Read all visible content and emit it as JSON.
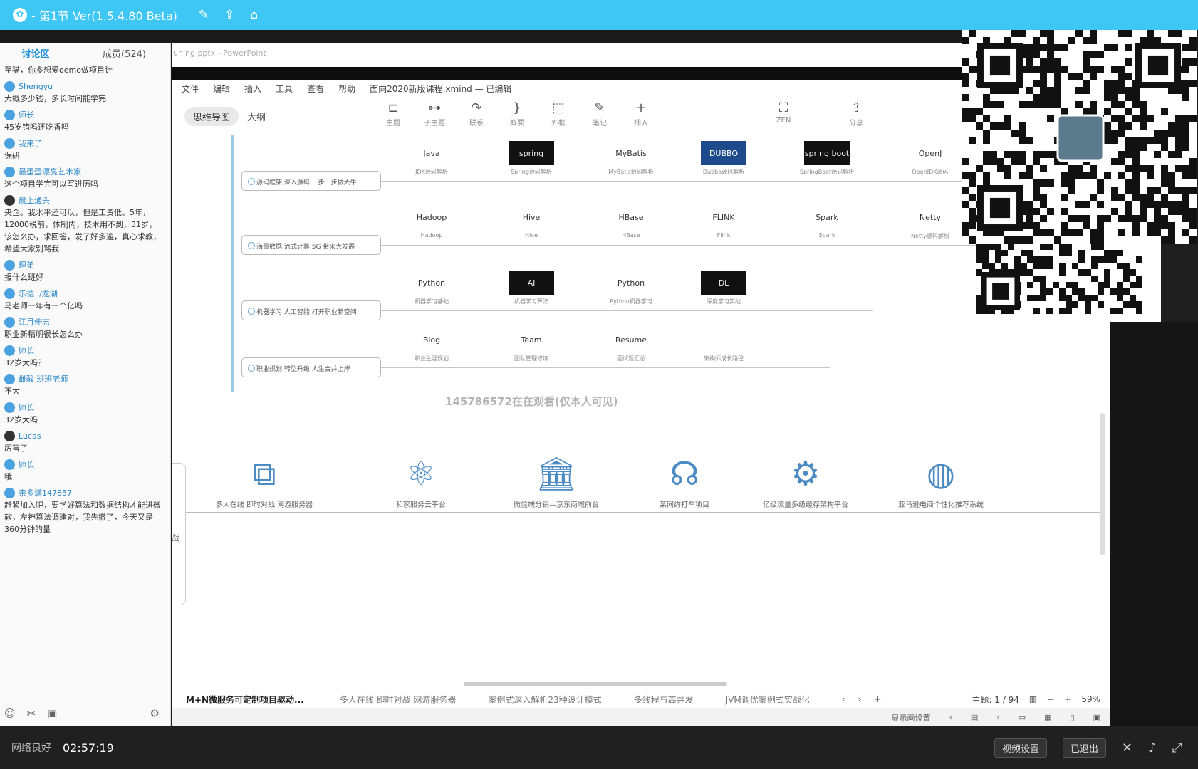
{
  "app": {
    "title": "- 第1节 Ver(1.5.4.80 Beta)",
    "icons": [
      "edit-icon",
      "share-out-icon",
      "home-icon"
    ]
  },
  "chat": {
    "tab": "讨论区",
    "members": "成员(524)",
    "messages": [
      {
        "user": "",
        "text": "至猫，你多想爱oemo做项目计"
      },
      {
        "user": "Shengyu",
        "text": "大概多少钱，多长时间能学完"
      },
      {
        "user": "师长",
        "text": "45岁错吗还吃香吗"
      },
      {
        "user": "我来了",
        "text": "保研"
      },
      {
        "user": "最蛋蛋漂亮艺术家",
        "text": "这个项目学完可以写进历吗"
      },
      {
        "user": "晨上通头",
        "text": "央企。我水平还可以，但是工资低。5年，12000税前，体制内，技术用不到，31岁，该怎么办，求回答，发了好多遍，真心求教，希望大家别骂我"
      },
      {
        "user": "理弟",
        "text": "报什么班好"
      },
      {
        "user": "乐德 :/龙湖",
        "text": "马老师一年有一个亿吗"
      },
      {
        "user": "江月伸志",
        "text": "职业新精明很长怎么办"
      },
      {
        "user": "师长",
        "text": "32岁大吗？"
      },
      {
        "user": "雌酸 班班老师",
        "text": "不大"
      },
      {
        "user": "师长",
        "text": "32岁大吗"
      },
      {
        "user": "Lucas",
        "text": "厉害了"
      },
      {
        "user": "师长",
        "text": "哦"
      },
      {
        "user": "亲多满147857",
        "text": "赶紧加入吧，要学好算法和数据结构才能进微软，左神算法调建对，我先撤了，今天又是360分钟的量"
      }
    ]
  },
  "screen": {
    "ppt_title": "uning pptx - PowerPoint",
    "menu": [
      "文件",
      "编辑",
      "插入",
      "工具",
      "查看",
      "帮助",
      "面向2020新版课程.xmind — 已编辑"
    ],
    "mode_tabs": {
      "mindmap": "思维导图",
      "outline": "大纲"
    },
    "tools": [
      {
        "icon": "topic-icon",
        "label": "主题"
      },
      {
        "icon": "subtopic-icon",
        "label": "子主题"
      },
      {
        "icon": "relation-icon",
        "label": "联系"
      },
      {
        "icon": "summary-icon",
        "label": "概要"
      },
      {
        "icon": "boundary-icon",
        "label": "外框"
      },
      {
        "icon": "note-icon",
        "label": "笔记"
      },
      {
        "icon": "insert-icon",
        "label": "插入"
      },
      {
        "icon": "zen-icon",
        "label": "ZEN"
      },
      {
        "icon": "share-icon",
        "label": "分享"
      }
    ],
    "branches": [
      {
        "label": "源码框架 深入源码 一步一步做大牛"
      },
      {
        "label": "海量数据 流式计算 5G 带来大发展"
      },
      {
        "label": "机器学习 人工智能 打开职业新空间"
      },
      {
        "label": "职业规划 转型升级 人生合并上岸"
      }
    ],
    "row1": [
      {
        "img": "Java",
        "cap": "JDK源码解析"
      },
      {
        "img": "spring",
        "cap": "Spring源码解析"
      },
      {
        "img": "MyBatis",
        "cap": "MyBatis源码解析"
      },
      {
        "img": "DUBBO",
        "cap": "Dubbo源码解析"
      },
      {
        "img": "spring boot",
        "cap": "SpringBoot源码解析"
      },
      {
        "img": "OpenJ",
        "cap": "OpenJDK源码"
      }
    ],
    "row2": [
      {
        "img": "Hadoop",
        "cap": "Hadoop"
      },
      {
        "img": "Hive",
        "cap": "Hive"
      },
      {
        "img": "HBase",
        "cap": "HBase"
      },
      {
        "img": "FLINK",
        "cap": "Flink"
      },
      {
        "img": "Spark",
        "cap": "Spark"
      },
      {
        "img": "Netty",
        "cap": "Netty源码解析"
      }
    ],
    "row3": [
      {
        "img": "Python",
        "cap": "机器学习基础"
      },
      {
        "img": "AI",
        "cap": "机器学习算法"
      },
      {
        "img": "Python",
        "cap": "Python机器学习"
      },
      {
        "img": "DL",
        "cap": "深度学习实战"
      }
    ],
    "row4": [
      {
        "img": "Blog",
        "cap": "职业生涯规划"
      },
      {
        "img": "Team",
        "cap": "团队管理修炼"
      },
      {
        "img": "Resume",
        "cap": "面试题汇总"
      },
      {
        "img": "",
        "cap": "架构师成长路径"
      }
    ],
    "watermark": "145786572在在观看(仅本人可见)",
    "projects": [
      {
        "icon": "flowchart-icon",
        "cap": "多人在线 即时对战 网游服务器"
      },
      {
        "icon": "atom-icon",
        "cap": "和家服务云平台"
      },
      {
        "icon": "building-icon",
        "cap": "微信端分销—京东商城前台"
      },
      {
        "icon": "headphones-icon",
        "cap": "某网约打车项目"
      },
      {
        "icon": "gears-icon",
        "cap": "亿级流量多级缓存架构平台"
      },
      {
        "icon": "globe-icon",
        "cap": "亚马逊电商个性化推荐系统"
      }
    ],
    "side_label": "战",
    "bottom_tabs": [
      "M+N微服务可定制项目驱动...",
      "多人在线 即时对战 网游服务器",
      "案例式深入解析23种设计模式",
      "多线程与高并发",
      "JVM调优案例式实战化"
    ],
    "topic_count": "主题: 1 / 94",
    "zoom": "59%",
    "player_label": "显示画设置"
  },
  "status": {
    "network": "网络良好",
    "time": "02:57:19",
    "video_settings": "视频设置",
    "exit": "已退出"
  }
}
